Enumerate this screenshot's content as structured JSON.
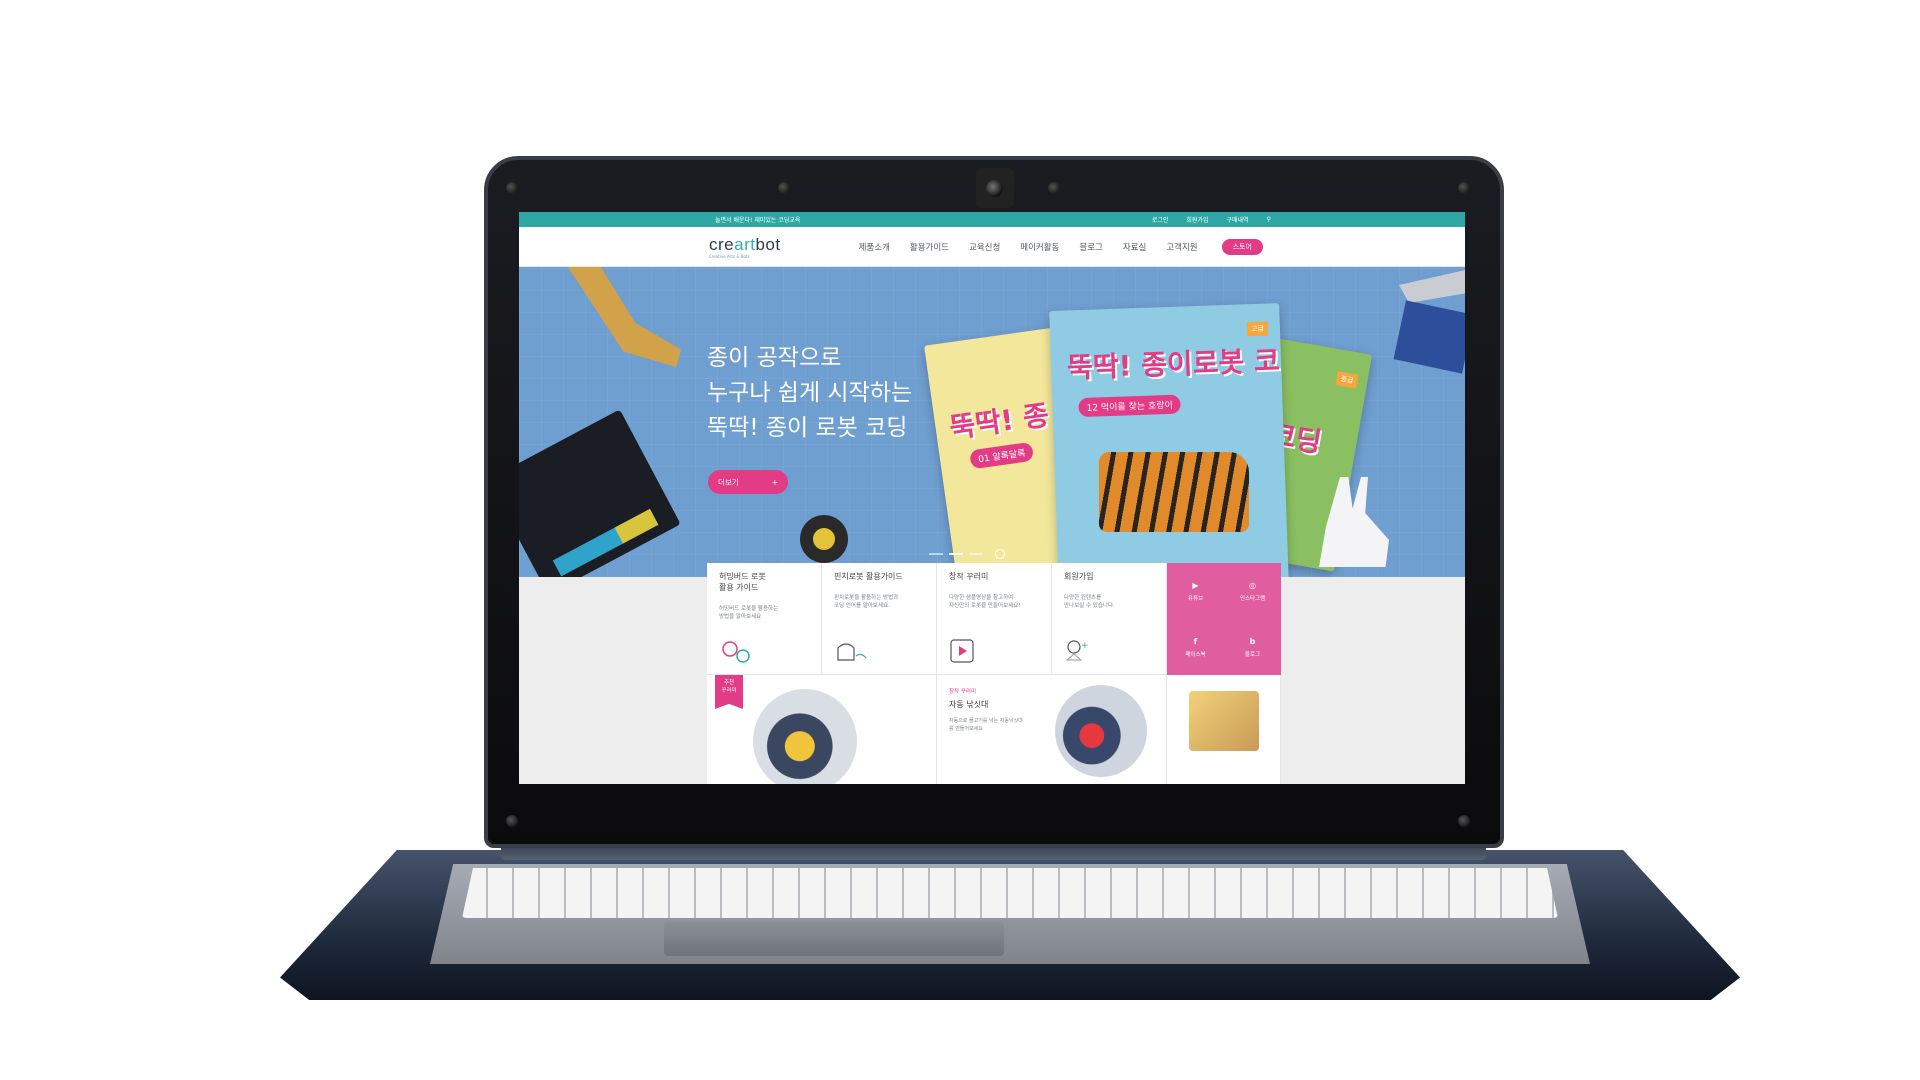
{
  "site": {
    "topbar": {
      "slogan": "놀면서 배운다! 재미있는 코딩교육",
      "links": [
        "로그인",
        "회원가입",
        "구매내역"
      ],
      "search_icon": "search-icon"
    },
    "logo": {
      "word_start": "cre",
      "word_accent": "art",
      "word_end": "bot",
      "tagline": "Creative Arts & Bots"
    },
    "nav": {
      "items": [
        "제품소개",
        "활용가이드",
        "교육신청",
        "메이커활동",
        "블로그",
        "자료실",
        "고객지원"
      ],
      "store_label": "스토어"
    },
    "hero": {
      "title_lines": [
        "종이 공작으로",
        "누구나 쉽게 시작하는",
        "뚝딱! 종이 로봇 코딩"
      ],
      "more_label": "더보기",
      "more_icon": "plus-icon",
      "book_blue_title": "뚝딱! 종이로봇 코딩",
      "book_blue_tag": "12 먹이를 찾는 호랑이",
      "book_blue_level": "고급",
      "book_yellow_title": "뚝딱! 종",
      "book_yellow_tag": "01 알록달록",
      "book_green_title": "봇 코딩",
      "book_green_level": "중급"
    },
    "cards": [
      {
        "title": "허밍버드 로봇\n활용 가이드",
        "desc": "허밍버드 로봇을 활용하는\n방법을 알아보세요",
        "icon": "gear-icon"
      },
      {
        "title": "핀치로봇 활용가이드",
        "desc": "핀치로봇을 활용하는 방법과\n코딩 언어를 알아보세요.",
        "icon": "robot-icon"
      },
      {
        "title": "창작 꾸러미",
        "desc": "다양한 샘플영상을 참고하여\n자신만의 로봇을 만들어보세요!",
        "icon": "play-icon"
      },
      {
        "title": "회원가입",
        "desc": "다양한 컨텐츠를\n만나보실 수 있습니다.",
        "icon": "user-plus-icon"
      }
    ],
    "social": [
      {
        "label": "유튜브",
        "icon": "youtube-icon",
        "glyph": "▶"
      },
      {
        "label": "인스타그램",
        "icon": "instagram-icon",
        "glyph": "◎"
      },
      {
        "label": "페이스북",
        "icon": "facebook-icon",
        "glyph": "f"
      },
      {
        "label": "블로그",
        "icon": "blog-icon",
        "glyph": "b"
      }
    ],
    "row2": {
      "ribbon": "추천\n꾸러미",
      "category": "창작 꾸러미",
      "title": "자동 낚싯대",
      "desc": "자동으로 물고기를 낚는 자동낚싯대\n를 만들어보세요"
    },
    "colors": {
      "teal": "#2fa8a5",
      "pink": "#e23c87",
      "hero_blue": "#6f9ed0",
      "social_pink": "#e05ea0"
    }
  }
}
